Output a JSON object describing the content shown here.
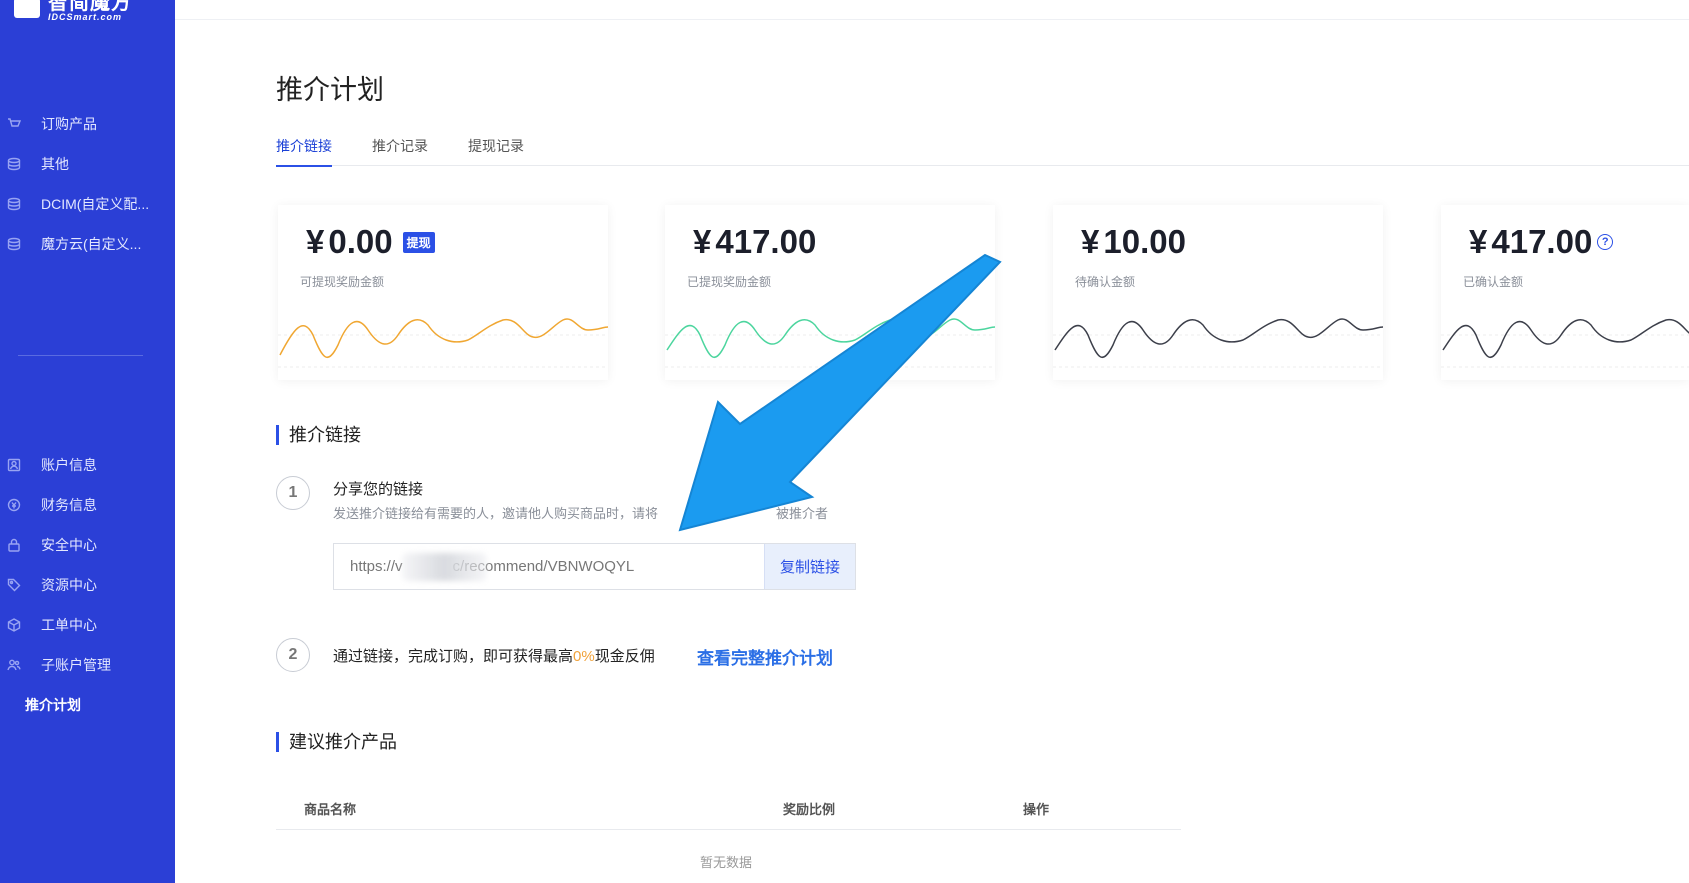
{
  "brand": {
    "name_cn": "智简魔方",
    "name_en": "IDCSmart.com"
  },
  "sidebar": {
    "top_items": [
      {
        "label": "订购产品",
        "icon": "cart-icon"
      },
      {
        "label": "其他",
        "icon": "database-icon"
      },
      {
        "label": "DCIM(自定义配...",
        "icon": "database-icon"
      },
      {
        "label": "魔方云(自定义...",
        "icon": "database-icon"
      }
    ],
    "bottom_items": [
      {
        "label": "账户信息",
        "icon": "user-card-icon"
      },
      {
        "label": "财务信息",
        "icon": "finance-icon"
      },
      {
        "label": "安全中心",
        "icon": "lock-icon"
      },
      {
        "label": "资源中心",
        "icon": "tag-icon"
      },
      {
        "label": "工单中心",
        "icon": "box-icon"
      },
      {
        "label": "子账户管理",
        "icon": "users-icon"
      },
      {
        "label": "推介计划",
        "icon": "",
        "active": true
      }
    ]
  },
  "page": {
    "title": "推介计划"
  },
  "tabs": [
    {
      "label": "推介链接",
      "active": true
    },
    {
      "label": "推介记录",
      "active": false
    },
    {
      "label": "提现记录",
      "active": false
    }
  ],
  "stats": [
    {
      "currency": "¥",
      "amount": "0.00",
      "label": "可提现奖励金额",
      "badge": "提现",
      "line_color": "#f0a732"
    },
    {
      "currency": "¥",
      "amount": "417.00",
      "label": "已提现奖励金额",
      "line_color": "#4cd59e"
    },
    {
      "currency": "¥",
      "amount": "10.00",
      "label": "待确认金额",
      "line_color": "#3c3f4a"
    },
    {
      "currency": "¥",
      "amount": "417.00",
      "label": "已确认金额",
      "help": "?",
      "line_color": "#3c3f4a"
    }
  ],
  "referral": {
    "section_title": "推介链接",
    "step1": {
      "num": "1",
      "title": "分享您的链接",
      "desc": "发送推介链接给有需要的人，邀请他人购买商品时，请将",
      "desc_tail": "被推介者"
    },
    "link_value": "https://v            c/recommend/VBNWOQYL",
    "copy_label": "复制链接",
    "step2": {
      "num": "2",
      "text_before": "通过链接，完成订购，即可获得最高",
      "percent": "0%",
      "text_after": "现金反佣",
      "link_label": "查看完整推介计划"
    }
  },
  "products": {
    "section_title": "建议推介产品",
    "columns": [
      "商品名称",
      "奖励比例",
      "操作"
    ],
    "empty": "暂无数据"
  },
  "colors": {
    "sidebar": "#2b3fd6",
    "accent": "#2b50e6",
    "arrow": "#1b9bf0",
    "percent": "#f0a23b"
  }
}
